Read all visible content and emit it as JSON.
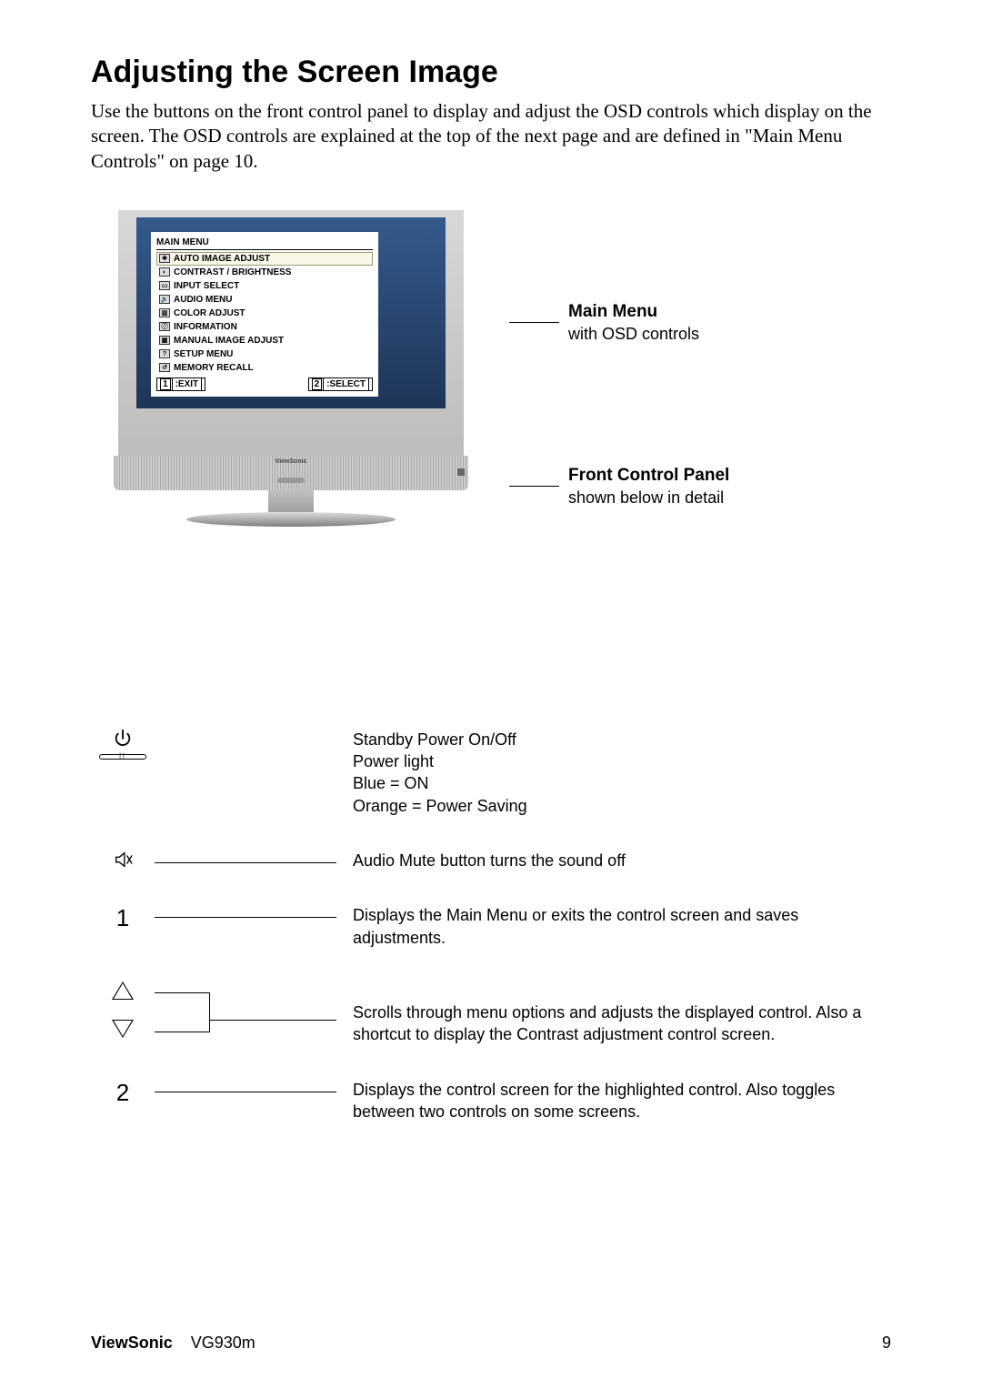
{
  "heading": "Adjusting the Screen Image",
  "intro": "Use the buttons on the front control panel to display and adjust the OSD controls which display on the screen. The OSD controls are explained at the top of the next page and are defined in \"Main Menu Controls\" on page 10.",
  "osd": {
    "title": "MAIN MENU",
    "items": [
      {
        "icon": "move-icon",
        "label": "AUTO IMAGE ADJUST"
      },
      {
        "icon": "contrast-icon",
        "label": "CONTRAST / BRIGHTNESS"
      },
      {
        "icon": "input-icon",
        "label": "INPUT SELECT"
      },
      {
        "icon": "speaker-icon",
        "label": "AUDIO MENU"
      },
      {
        "icon": "color-icon",
        "label": "COLOR ADJUST"
      },
      {
        "icon": "info-icon",
        "label": "INFORMATION"
      },
      {
        "icon": "manual-icon",
        "label": "MANUAL IMAGE ADJUST"
      },
      {
        "icon": "question-icon",
        "label": "SETUP MENU"
      },
      {
        "icon": "recall-icon",
        "label": "MEMORY RECALL"
      }
    ],
    "exit_key": "1",
    "exit_label": ":EXIT",
    "select_key": "2",
    "select_label": ":SELECT"
  },
  "callouts": {
    "main_menu_title": "Main Menu",
    "main_menu_sub": "with OSD controls",
    "fpc_title": "Front Control Panel",
    "fpc_sub": "shown below in detail"
  },
  "brand_on_bezel": "ViewSonic",
  "controls": {
    "power": {
      "line1": "Standby Power On/Off",
      "line2": "Power light",
      "line3": "Blue = ON",
      "line4": "Orange = Power Saving"
    },
    "mute": "Audio Mute button turns the sound off",
    "btn1": "Displays the Main Menu or exits the control screen and saves adjustments.",
    "arrows": "Scrolls through menu options and adjusts the displayed control. Also a shortcut to display the Contrast adjustment control screen.",
    "btn2": "Displays the control screen for the highlighted control. Also toggles between two controls on some screens.",
    "num1": "1",
    "num2": "2"
  },
  "footer": {
    "brand": "ViewSonic",
    "model": "VG930m",
    "page": "9"
  }
}
